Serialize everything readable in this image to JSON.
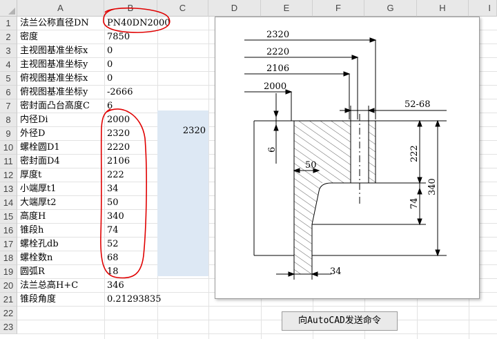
{
  "columns": [
    "A",
    "B",
    "C",
    "D",
    "E",
    "F",
    "G",
    "H",
    "I"
  ],
  "rows": [
    {
      "n": "1",
      "a": "法兰公称直径DN",
      "b": "PN40DN2000"
    },
    {
      "n": "2",
      "a": "密度",
      "b": "7850"
    },
    {
      "n": "3",
      "a": "主视图基准坐标x",
      "b": "0"
    },
    {
      "n": "4",
      "a": "主视图基准坐标y",
      "b": "0"
    },
    {
      "n": "5",
      "a": "俯视图基准坐标x",
      "b": "0"
    },
    {
      "n": "6",
      "a": "俯视图基准坐标y",
      "b": "-2666"
    },
    {
      "n": "7",
      "a": "密封面凸台高度C",
      "b": "6"
    },
    {
      "n": "8",
      "a": "内径Di",
      "b": "2000"
    },
    {
      "n": "9",
      "a": "外径D",
      "b": "2320"
    },
    {
      "n": "10",
      "a": "螺栓圆D1",
      "b": "2220"
    },
    {
      "n": "11",
      "a": "密封面D4",
      "b": "2106"
    },
    {
      "n": "12",
      "a": "厚度t",
      "b": "222"
    },
    {
      "n": "13",
      "a": "小端厚t1",
      "b": "34"
    },
    {
      "n": "14",
      "a": "大端厚t2",
      "b": "50"
    },
    {
      "n": "15",
      "a": "高度H",
      "b": "340"
    },
    {
      "n": "16",
      "a": "锥段h",
      "b": "74"
    },
    {
      "n": "17",
      "a": "螺栓孔db",
      "b": "52"
    },
    {
      "n": "18",
      "a": "螺栓数n",
      "b": "68"
    },
    {
      "n": "19",
      "a": "圆弧R",
      "b": "18"
    },
    {
      "n": "20",
      "a": "法兰总高H+C",
      "b": "346"
    },
    {
      "n": "21",
      "a": "锥段角度",
      "b": "0.21293835"
    },
    {
      "n": "22",
      "a": "",
      "b": ""
    },
    {
      "n": "23",
      "a": "",
      "b": ""
    }
  ],
  "c9_value": "2320",
  "drawing_labels": {
    "d2320": "2320",
    "d2220": "2220",
    "d2106": "2106",
    "d2000": "2000",
    "d5268": "52-68",
    "d222": "222",
    "d340": "340",
    "d74": "74",
    "d6": "6",
    "d50": "50",
    "d34": "34"
  },
  "send_button": "向AutoCAD发送命令",
  "colors": {
    "selection_fill": "#dde8f4",
    "annotation": "#e00000",
    "header_bg": "#e8e8e8"
  }
}
